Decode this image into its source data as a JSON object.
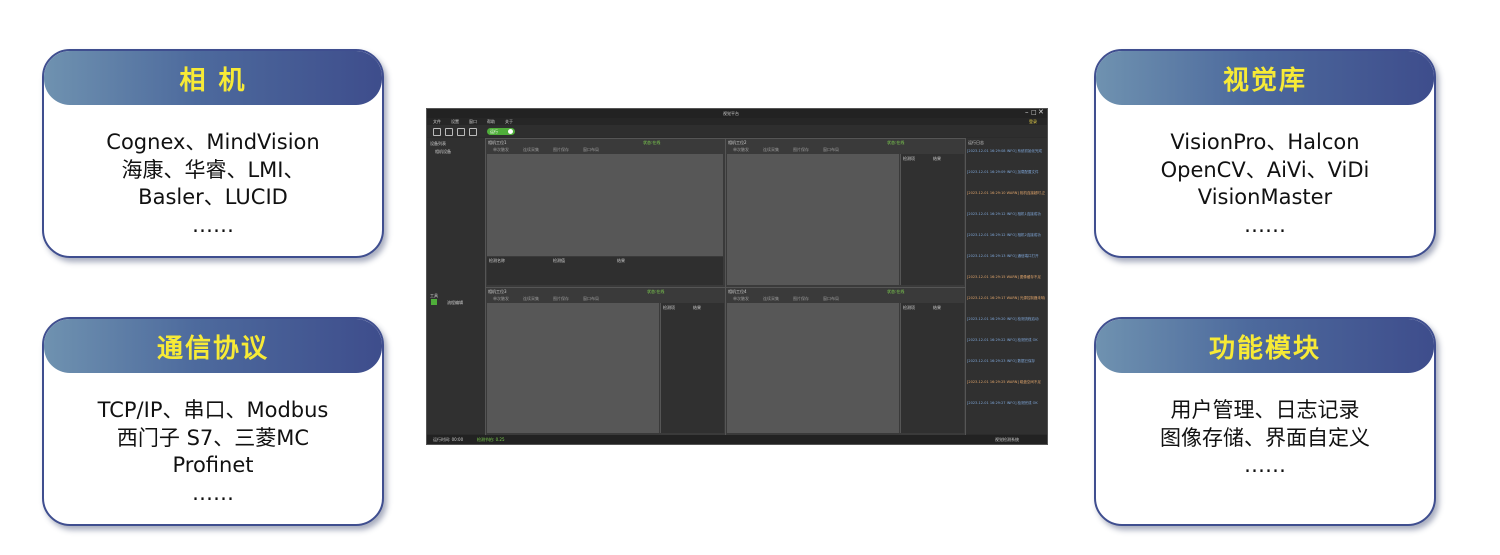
{
  "cards": {
    "camera": {
      "title": "相 机",
      "lines": [
        "Cognex、MindVision",
        "海康、华睿、LMI、",
        "Basler、LUCID",
        "……"
      ]
    },
    "comm": {
      "title": "通信协议",
      "lines": [
        "TCP/IP、串口、Modbus",
        "西门子 S7、三菱MC",
        "Profinet",
        "……"
      ]
    },
    "vision": {
      "title": "视觉库",
      "lines": [
        "VisionPro、Halcon",
        "OpenCV、AiVi、ViDi",
        "VisionMaster",
        "……"
      ]
    },
    "func": {
      "title": "功能模块",
      "lines": [
        "用户管理、日志记录",
        "图像存储、界面自定义",
        "……"
      ]
    }
  },
  "app": {
    "title": "视觉平台",
    "menu": [
      "文件",
      "设置",
      "窗口",
      "帮助",
      "关于"
    ],
    "top_right_label": "登录",
    "run_label": "运行",
    "panels": [
      {
        "title": "相机工位1",
        "status": "状态:在线",
        "tools": [
          "单次触发",
          "连续采集",
          "图片保存",
          "窗口布局"
        ]
      },
      {
        "title": "相机工位2",
        "status": "状态:在线",
        "tools": [
          "单次触发",
          "连续采集",
          "图片保存",
          "窗口布局"
        ]
      },
      {
        "title": "相机工位3",
        "status": "状态:在线",
        "tools": [
          "单次触发",
          "连续采集",
          "图片保存",
          "窗口布局"
        ]
      },
      {
        "title": "相机工位4",
        "status": "状态:在线",
        "tools": [
          "单次触发",
          "连续采集",
          "图片保存",
          "窗口布局"
        ]
      }
    ],
    "result_headers": [
      "检测项",
      "结果"
    ],
    "bottom_table_headers": [
      "检测名称",
      "检测值",
      "结果"
    ],
    "left_sidebar": {
      "section1": "设备列表",
      "item1": "相机设备",
      "section2": "工具",
      "item2": "流程编辑"
    },
    "log_title": "运行日志",
    "log_entries": [
      {
        "text": "[2023-12-01 16:29:08 INFO] 系统初始化完成",
        "color": "blue"
      },
      {
        "text": "[2023-12-01 16:29:09 INFO] 加载配置文件",
        "color": "blue"
      },
      {
        "text": "[2023-12-01 16:29:10 WARN] 相机连接超时,正在重试",
        "color": "orange"
      },
      {
        "text": "[2023-12-01 16:29:12 INFO] 相机1连接成功",
        "color": "blue"
      },
      {
        "text": "[2023-12-01 16:29:12 INFO] 相机2连接成功",
        "color": "blue"
      },
      {
        "text": "[2023-12-01 16:29:13 INFO] 通信端口打开",
        "color": "blue"
      },
      {
        "text": "[2023-12-01 16:29:15 WARN] 图像缓存不足",
        "color": "orange"
      },
      {
        "text": "[2023-12-01 16:29:17 WARN] 光源控制器未响应",
        "color": "orange"
      },
      {
        "text": "[2023-12-01 16:29:20 INFO] 检测流程启动",
        "color": "blue"
      },
      {
        "text": "[2023-12-01 16:29:22 INFO] 检测完成 OK",
        "color": "blue"
      },
      {
        "text": "[2023-12-01 16:29:23 INFO] 数据已保存",
        "color": "blue"
      },
      {
        "text": "[2023-12-01 16:29:25 WARN] 磁盘空间不足",
        "color": "orange"
      },
      {
        "text": "[2023-12-01 16:29:27 INFO] 检测完成 OK",
        "color": "blue"
      }
    ],
    "status_left": "运行时间: 00:00",
    "status_mid": "检测节拍: 0.25",
    "status_right": "视觉检测系统"
  }
}
